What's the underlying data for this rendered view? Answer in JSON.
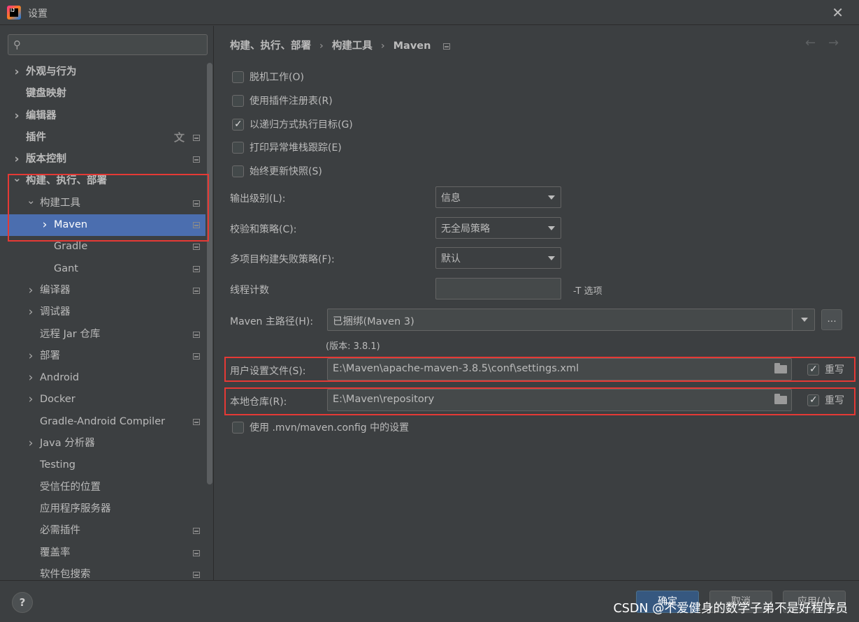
{
  "window": {
    "title": "设置",
    "app_icon_text": "IJ"
  },
  "sidebar": {
    "search_placeholder": "",
    "items": [
      {
        "label": "外观与行为",
        "level": 0,
        "expand": "collapsed",
        "bold": true,
        "proj": false
      },
      {
        "label": "键盘映射",
        "level": 0,
        "expand": "none",
        "bold": true,
        "proj": false
      },
      {
        "label": "编辑器",
        "level": 0,
        "expand": "collapsed",
        "bold": true,
        "proj": false
      },
      {
        "label": "插件",
        "level": 0,
        "expand": "none",
        "bold": true,
        "proj": true,
        "translate": true
      },
      {
        "label": "版本控制",
        "level": 0,
        "expand": "collapsed",
        "bold": true,
        "proj": true
      },
      {
        "label": "构建、执行、部署",
        "level": 0,
        "expand": "expanded",
        "bold": true,
        "proj": false
      },
      {
        "label": "构建工具",
        "level": 1,
        "expand": "expanded",
        "bold": false,
        "proj": true
      },
      {
        "label": "Maven",
        "level": 2,
        "expand": "collapsed",
        "bold": false,
        "proj": true,
        "selected": true
      },
      {
        "label": "Gradle",
        "level": 2,
        "expand": "none",
        "bold": false,
        "proj": true
      },
      {
        "label": "Gant",
        "level": 2,
        "expand": "none",
        "bold": false,
        "proj": true
      },
      {
        "label": "编译器",
        "level": 1,
        "expand": "collapsed",
        "bold": false,
        "proj": true
      },
      {
        "label": "调试器",
        "level": 1,
        "expand": "collapsed",
        "bold": false,
        "proj": false
      },
      {
        "label": "远程 Jar 仓库",
        "level": 1,
        "expand": "none",
        "bold": false,
        "proj": true
      },
      {
        "label": "部署",
        "level": 1,
        "expand": "collapsed",
        "bold": false,
        "proj": true
      },
      {
        "label": "Android",
        "level": 1,
        "expand": "collapsed",
        "bold": false,
        "proj": false
      },
      {
        "label": "Docker",
        "level": 1,
        "expand": "collapsed",
        "bold": false,
        "proj": false
      },
      {
        "label": "Gradle-Android Compiler",
        "level": 1,
        "expand": "none",
        "bold": false,
        "proj": true
      },
      {
        "label": "Java 分析器",
        "level": 1,
        "expand": "collapsed",
        "bold": false,
        "proj": false
      },
      {
        "label": "Testing",
        "level": 1,
        "expand": "none",
        "bold": false,
        "proj": false
      },
      {
        "label": "受信任的位置",
        "level": 1,
        "expand": "none",
        "bold": false,
        "proj": false
      },
      {
        "label": "应用程序服务器",
        "level": 1,
        "expand": "none",
        "bold": false,
        "proj": false
      },
      {
        "label": "必需插件",
        "level": 1,
        "expand": "none",
        "bold": false,
        "proj": true
      },
      {
        "label": "覆盖率",
        "level": 1,
        "expand": "none",
        "bold": false,
        "proj": true
      },
      {
        "label": "软件包搜索",
        "level": 1,
        "expand": "none",
        "bold": false,
        "proj": true
      }
    ]
  },
  "breadcrumb": {
    "part1": "构建、执行、部署",
    "part2": "构建工具",
    "part3": "Maven",
    "sep": "›"
  },
  "options": {
    "offline": {
      "label": "脱机工作(O)",
      "checked": false
    },
    "plugin_registry": {
      "label": "使用插件注册表(R)",
      "checked": false
    },
    "recursive": {
      "label": "以递归方式执行目标(G)",
      "checked": true
    },
    "print_stack": {
      "label": "打印异常堆栈跟踪(E)",
      "checked": false
    },
    "always_update": {
      "label": "始终更新快照(S)",
      "checked": false
    }
  },
  "fields": {
    "output_level": {
      "label": "输出级别(L):",
      "value": "信息"
    },
    "checksum": {
      "label": "校验和策略(C):",
      "value": "无全局策略"
    },
    "multiproject": {
      "label": "多项目构建失败策略(F):",
      "value": "默认"
    },
    "threads": {
      "label": "线程计数",
      "value": "",
      "hint": "-T 选项"
    },
    "maven_home": {
      "label": "Maven 主路径(H):",
      "value": "已捆绑(Maven 3)",
      "version": "(版本: 3.8.1)",
      "browse": "..."
    },
    "user_settings": {
      "label": "用户设置文件(S):",
      "value": "E:\\Maven\\apache-maven-3.8.5\\conf\\settings.xml",
      "override_label": "重写",
      "override": true
    },
    "local_repo": {
      "label": "本地仓库(R):",
      "value": "E:\\Maven\\repository",
      "override_label": "重写",
      "override": true
    },
    "mvn_config": {
      "label": "使用 .mvn/maven.config 中的设置",
      "checked": false
    }
  },
  "footer": {
    "help": "?",
    "ok": "确定",
    "cancel": "取消",
    "apply": "应用(A)",
    "watermark": "CSDN @不爱健身的数学子弟不是好程序员"
  },
  "colors": {
    "highlight": "#e53935",
    "selection": "#4b6eaf",
    "background": "#3c3f41"
  }
}
